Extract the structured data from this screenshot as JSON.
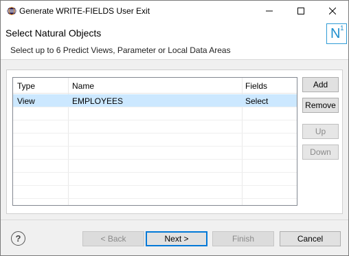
{
  "window": {
    "title": "Generate WRITE-FIELDS User Exit",
    "app_icon": "eclipse-icon",
    "controls": {
      "minimize": "minimize-icon",
      "maximize": "maximize-icon",
      "close": "close-icon"
    }
  },
  "header": {
    "title": "Select Natural Objects",
    "description": "Select up to 6 Predict Views, Parameter or Local Data Areas",
    "logo": {
      "letter": "N",
      "superscript": "1"
    }
  },
  "table": {
    "columns": [
      "Type",
      "Name",
      "Fields"
    ],
    "rows": [
      {
        "type": "View",
        "name": "EMPLOYEES",
        "fields": "Select",
        "selected": true
      }
    ]
  },
  "side_buttons": {
    "add": "Add",
    "remove": "Remove",
    "up": "Up",
    "down": "Down"
  },
  "footer": {
    "help_icon": "help-icon",
    "back": "< Back",
    "next": "Next >",
    "finish": "Finish",
    "cancel": "Cancel"
  },
  "colors": {
    "selection": "#cce8ff",
    "accent": "#0078d7",
    "logo": "#1f8fce"
  }
}
